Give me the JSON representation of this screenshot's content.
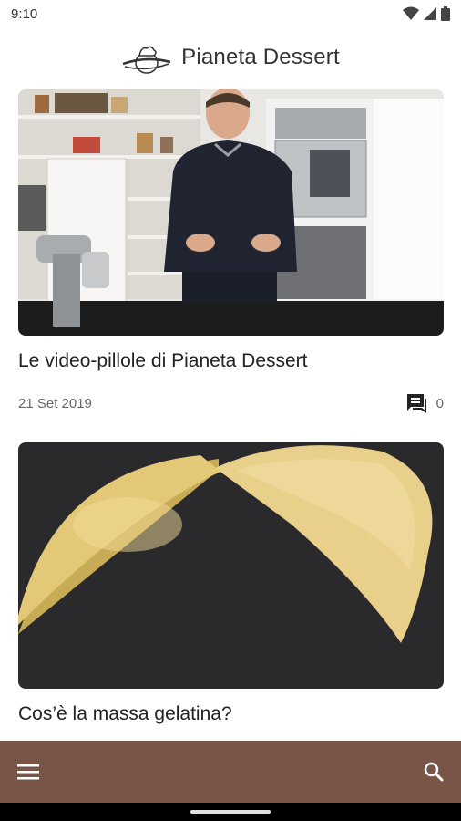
{
  "status_bar": {
    "time": "9:10",
    "icons": [
      "wifi-icon",
      "signal-icon",
      "battery-icon"
    ]
  },
  "header": {
    "title": "Pianeta Dessert",
    "logo_icon": "planet-chef-hat-logo"
  },
  "articles": [
    {
      "title": "Le video-pillole di Pianeta Dessert",
      "date": "21 Set 2019",
      "comments": "0",
      "image": "chef-in-kitchen-photo"
    },
    {
      "title": "Cos’è la massa gelatina?",
      "image": "gelatin-mass-photo"
    }
  ],
  "bottom_bar": {
    "menu_icon": "menu-icon",
    "search_icon": "search-icon",
    "color": "#795548"
  }
}
